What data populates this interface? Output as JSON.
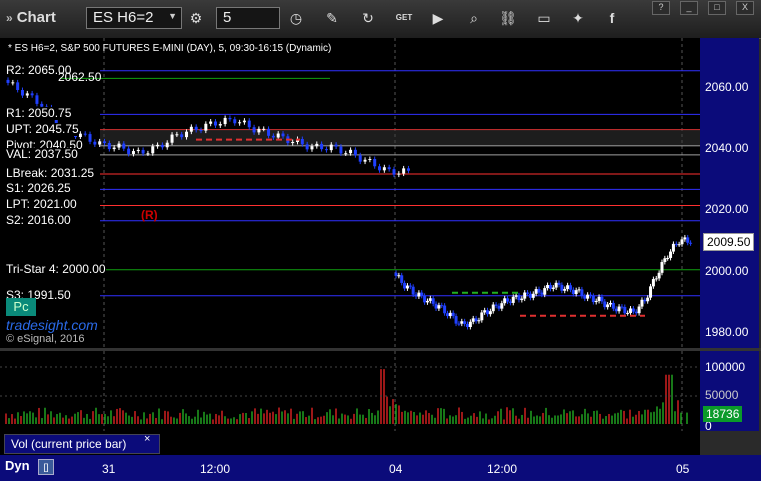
{
  "toolbar": {
    "title": "Chart",
    "symbol": "ES H6=2",
    "interval": "5",
    "icons": [
      "gear-icon",
      "clock-icon",
      "pencil-icon",
      "refresh-icon",
      "get-icon",
      "play-icon",
      "search-icon",
      "link-icon",
      "comment-icon",
      "twitter-icon",
      "facebook-icon"
    ]
  },
  "window_buttons": [
    "?",
    "_",
    "□",
    "X"
  ],
  "chart_header": "* ES H6=2, S&P 500 FUTURES E-MINI (DAY), 5, 09:30-16:15 (Dynamic)",
  "level_labels": [
    {
      "key": "r2",
      "text": "R2: 2065.00",
      "price": 2065.0,
      "color": "#3030ff"
    },
    {
      "key": "r2b",
      "text": "2062.50",
      "price": 2062.5,
      "color": "#10a010"
    },
    {
      "key": "r1",
      "text": "R1: 2050.75",
      "price": 2050.75,
      "color": "#3030ff"
    },
    {
      "key": "upt",
      "text": "UPT: 2045.75",
      "price": 2045.75,
      "color": "#ff3030"
    },
    {
      "key": "pivot",
      "text": "Pivot: 2040.50",
      "price": 2040.5,
      "color": "#c0c0c0"
    },
    {
      "key": "val",
      "text": "VAL: 2037.50",
      "price": 2037.5,
      "color": "#a0a0a0"
    },
    {
      "key": "lbreak",
      "text": "LBreak: 2031.25",
      "price": 2031.25,
      "color": "#ff3030"
    },
    {
      "key": "s1",
      "text": "S1: 2026.25",
      "price": 2026.25,
      "color": "#3030ff"
    },
    {
      "key": "lpt",
      "text": "LPT: 2021.00",
      "price": 2021.0,
      "color": "#ff3030"
    },
    {
      "key": "s2",
      "text": "S2: 2016.00",
      "price": 2016.0,
      "color": "#3030ff"
    },
    {
      "key": "tristar",
      "text": "Tri-Star 4: 2000.00",
      "price": 2000.0,
      "color": "#10a010"
    },
    {
      "key": "s3",
      "text": "S3: 1991.50",
      "price": 1991.5,
      "color": "#3030ff"
    }
  ],
  "marker_r": "(R)",
  "pc_label": "Pc",
  "brand": "tradesight.com",
  "copyright": "© eSignal, 2016",
  "price_axis": {
    "ticks": [
      "2060.00",
      "2040.00",
      "2020.00",
      "2000.00",
      "1980.00"
    ],
    "last_price": "2009.50"
  },
  "volume_axis": {
    "ticks": [
      "100000",
      "50000",
      "0"
    ],
    "last_volume": "18736"
  },
  "volume_label": "Vol (current price bar)",
  "volume_close": "×",
  "time_axis": {
    "labels": [
      "31",
      "12:00",
      "04",
      "12:00",
      "05"
    ]
  },
  "dyn_label": "Dyn",
  "dyn_icon": "[]",
  "chart_data": {
    "type": "candlestick",
    "symbol": "ES H6=2",
    "interval": "5",
    "ylim": [
      1972,
      2080
    ],
    "x_labels": [
      "31",
      "12:00",
      "04",
      "12:00",
      "05"
    ],
    "sessions": [
      {
        "date": "31",
        "approx_path": [
          2062,
          2058,
          2054,
          2046,
          2044,
          2041,
          2040,
          2038,
          2040,
          2044,
          2046,
          2048,
          2049,
          2046,
          2044,
          2042,
          2040,
          2040,
          2038,
          2035,
          2032
        ]
      },
      {
        "date": "04",
        "approx_path": [
          1999,
          1995,
          1992,
          1990,
          1988,
          1985,
          1982,
          1983,
          1986,
          1988,
          1990,
          1991,
          1992,
          1993,
          1995,
          1994,
          1993,
          1991,
          1990,
          1988,
          1987,
          1986,
          1990,
          1998,
          2005,
          2009.5
        ]
      }
    ],
    "volume_peaks": [
      {
        "x": "04 open",
        "value": 98000
      },
      {
        "x": "05 open",
        "value": 88000
      }
    ]
  }
}
